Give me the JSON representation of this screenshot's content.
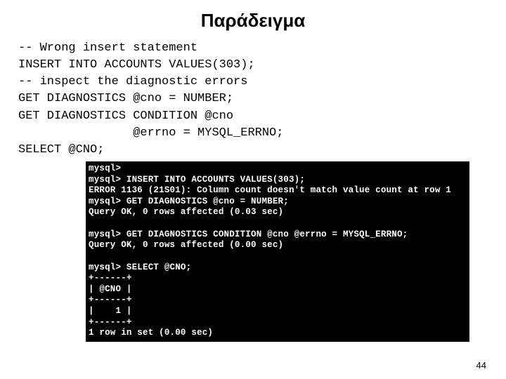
{
  "title": "Παράδειγμα",
  "code": {
    "l1": "-- Wrong insert statement",
    "l2": "INSERT INTO ACCOUNTS VALUES(303);",
    "l3": "-- inspect the diagnostic errors",
    "l4": "GET DIAGNOSTICS @cno = NUMBER;",
    "l5": "GET DIAGNOSTICS CONDITION @cno",
    "l6": "                @errno = MYSQL_ERRNO;",
    "l7": "SELECT @CNO;"
  },
  "terminal": {
    "t01": "mysql>",
    "t02": "mysql> INSERT INTO ACCOUNTS VALUES(303);",
    "t03": "ERROR 1136 (21S01): Column count doesn't match value count at row 1",
    "t04": "mysql> GET DIAGNOSTICS @cno = NUMBER;",
    "t05": "Query OK, 0 rows affected (0.03 sec)",
    "t06": "",
    "t07": "mysql> GET DIAGNOSTICS CONDITION @cno @errno = MYSQL_ERRNO;",
    "t08": "Query OK, 0 rows affected (0.00 sec)",
    "t09": "",
    "t10": "mysql> SELECT @CNO;",
    "t11": "+------+",
    "t12": "| @CNO |",
    "t13": "+------+",
    "t14": "|    1 |",
    "t15": "+------+",
    "t16": "1 row in set (0.00 sec)"
  },
  "page": "44"
}
